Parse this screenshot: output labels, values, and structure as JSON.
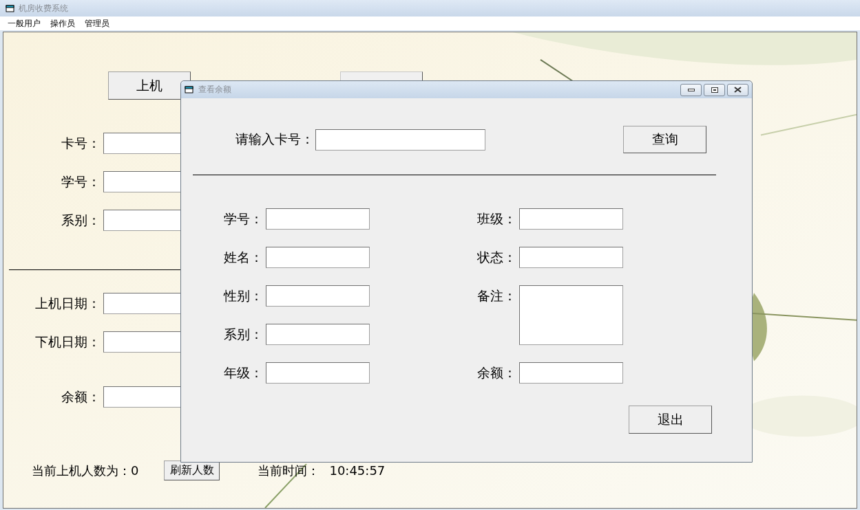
{
  "window": {
    "title": "机房收费系统"
  },
  "menu": [
    "一般用户",
    "操作员",
    "管理员"
  ],
  "main": {
    "buttons": [
      {
        "kind": "labelled",
        "label": "上机"
      },
      {
        "kind": "covered"
      }
    ],
    "fields": [
      {
        "label": "卡号："
      },
      {
        "label": "学号："
      },
      {
        "label": "系别："
      }
    ],
    "dates": [
      {
        "label": "上机日期："
      },
      {
        "label": "下机日期："
      }
    ],
    "balance": {
      "label": "余额："
    },
    "status": {
      "count_label": "当前上机人数为：",
      "count": "0",
      "refresh_button": "刷新人数",
      "time_label": "当前时间：",
      "time": "10:45:57"
    }
  },
  "dialog": {
    "title": "查看余额",
    "card_label": "请输入卡号：",
    "query_button": "查询",
    "left_fields": [
      {
        "label": "学号："
      },
      {
        "label": "姓名："
      },
      {
        "label": "性别："
      },
      {
        "label": "系别："
      },
      {
        "label": "年级："
      }
    ],
    "right_fields": [
      {
        "label": "班级：",
        "kind": "input"
      },
      {
        "label": "状态：",
        "kind": "input"
      },
      {
        "label": "备注：",
        "kind": "textarea"
      },
      {
        "label": "余额：",
        "kind": "input"
      }
    ],
    "exit_button": "退出"
  }
}
